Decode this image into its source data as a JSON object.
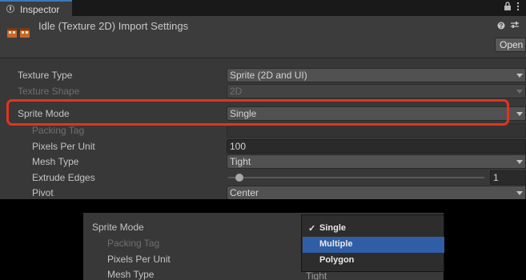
{
  "tab": {
    "label": "Inspector"
  },
  "asset": {
    "title": "Idle (Texture 2D) Import Settings",
    "open_label": "Open"
  },
  "fields": {
    "texture_type": {
      "label": "Texture Type",
      "value": "Sprite (2D and UI)"
    },
    "texture_shape": {
      "label": "Texture Shape",
      "value": "2D"
    },
    "sprite_mode": {
      "label": "Sprite Mode",
      "value": "Single"
    },
    "packing_tag": {
      "label": "Packing Tag",
      "value": ""
    },
    "pixels_per_unit": {
      "label": "Pixels Per Unit",
      "value": "100"
    },
    "mesh_type": {
      "label": "Mesh Type",
      "value": "Tight"
    },
    "extrude_edges": {
      "label": "Extrude Edges",
      "value": "1"
    },
    "pivot": {
      "label": "Pivot",
      "value": "Center"
    }
  },
  "inset": {
    "sprite_mode_label": "Sprite Mode",
    "packing_tag_label": "Packing Tag",
    "pixels_per_unit_label": "Pixels Per Unit",
    "mesh_type_label": "Mesh Type",
    "mesh_type_value": "Tight",
    "menu_options": [
      "Single",
      "Multiple",
      "Polygon"
    ],
    "selected_option": "Single",
    "hovered_option": "Multiple"
  },
  "colors": {
    "highlight": "#e1341f",
    "menu_hover": "#2f5ea6",
    "tab_accent": "#3a79bb"
  }
}
